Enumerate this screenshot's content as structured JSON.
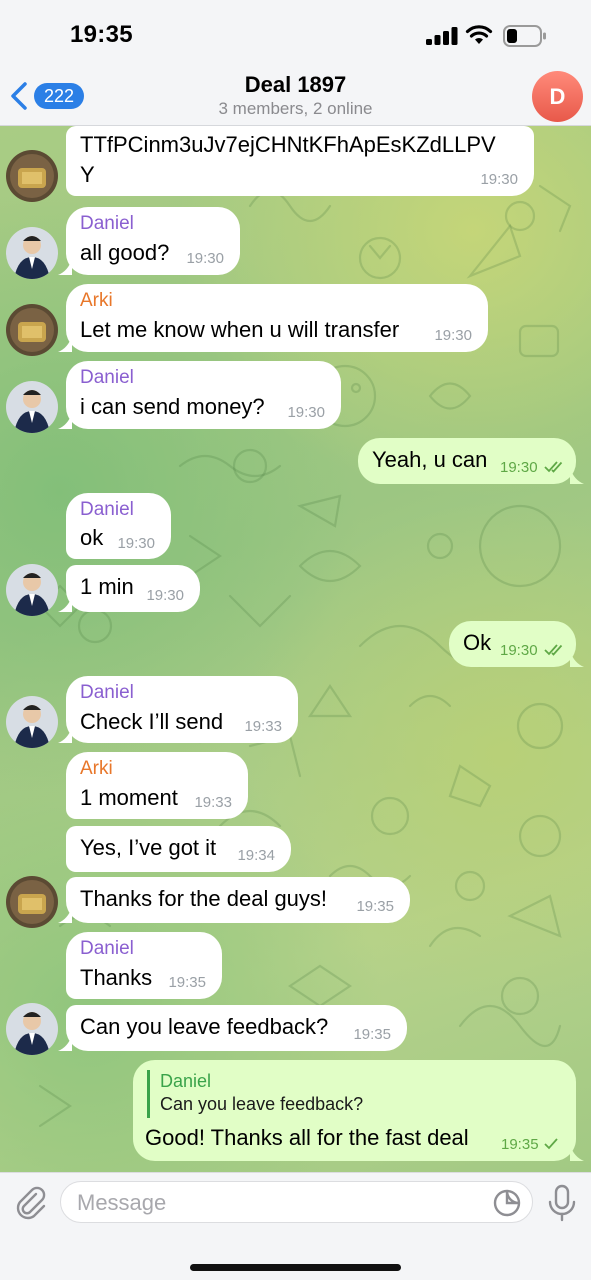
{
  "status_bar": {
    "time": "19:35"
  },
  "header": {
    "back_count": "222",
    "title": "Deal 1897",
    "subtitle": "3 members, 2 online",
    "avatar_initial": "D"
  },
  "messages": [
    {
      "sender": "",
      "lines": [
        "TTfPCinm3uJv7ejCHNtKFhApEsKZdLLPV",
        "Y"
      ],
      "time": "19:30"
    },
    {
      "sender": "Daniel",
      "text": "all good?",
      "time": "19:30"
    },
    {
      "sender": "Arki",
      "text": "Let me know when u will transfer",
      "time": "19:30"
    },
    {
      "sender": "Daniel",
      "text": "i can send money?",
      "time": "19:30"
    },
    {
      "sender": "me",
      "text": "Yeah, u can",
      "time": "19:30",
      "status": "read"
    },
    {
      "sender": "Daniel",
      "text": "ok",
      "time": "19:30"
    },
    {
      "sender": "",
      "text": "1 min",
      "time": "19:30"
    },
    {
      "sender": "me",
      "text": "Ok",
      "time": "19:30",
      "status": "read"
    },
    {
      "sender": "Daniel",
      "text": "Check I’ll send",
      "time": "19:33"
    },
    {
      "sender": "Arki",
      "text": "1 moment",
      "time": "19:33"
    },
    {
      "sender": "",
      "text": "Yes, I’ve got it",
      "time": "19:34"
    },
    {
      "sender": "",
      "text": "Thanks for the deal guys!",
      "time": "19:35"
    },
    {
      "sender": "Daniel",
      "text": "Thanks",
      "time": "19:35"
    },
    {
      "sender": "",
      "text": "Can you leave feedback?",
      "time": "19:35"
    },
    {
      "sender": "me",
      "reply_to": {
        "name": "Daniel",
        "text": "Can you leave feedback?"
      },
      "text": "Good! Thanks all for the fast deal",
      "time": "19:35",
      "status": "sent"
    }
  ],
  "input": {
    "placeholder": "Message"
  },
  "colors": {
    "accent": "#2b7fe6",
    "incoming_bubble": "#ffffff",
    "outgoing_bubble": "#e1fec6",
    "daniel_name": "#8a5fd0",
    "arki_name": "#e8772a",
    "reply_name": "#3aa34a"
  },
  "icons": [
    "back-chevron-icon",
    "signal-icon",
    "wifi-icon",
    "battery-icon",
    "attach-icon",
    "sticker-icon",
    "microphone-icon",
    "double-check-icon",
    "check-icon"
  ]
}
